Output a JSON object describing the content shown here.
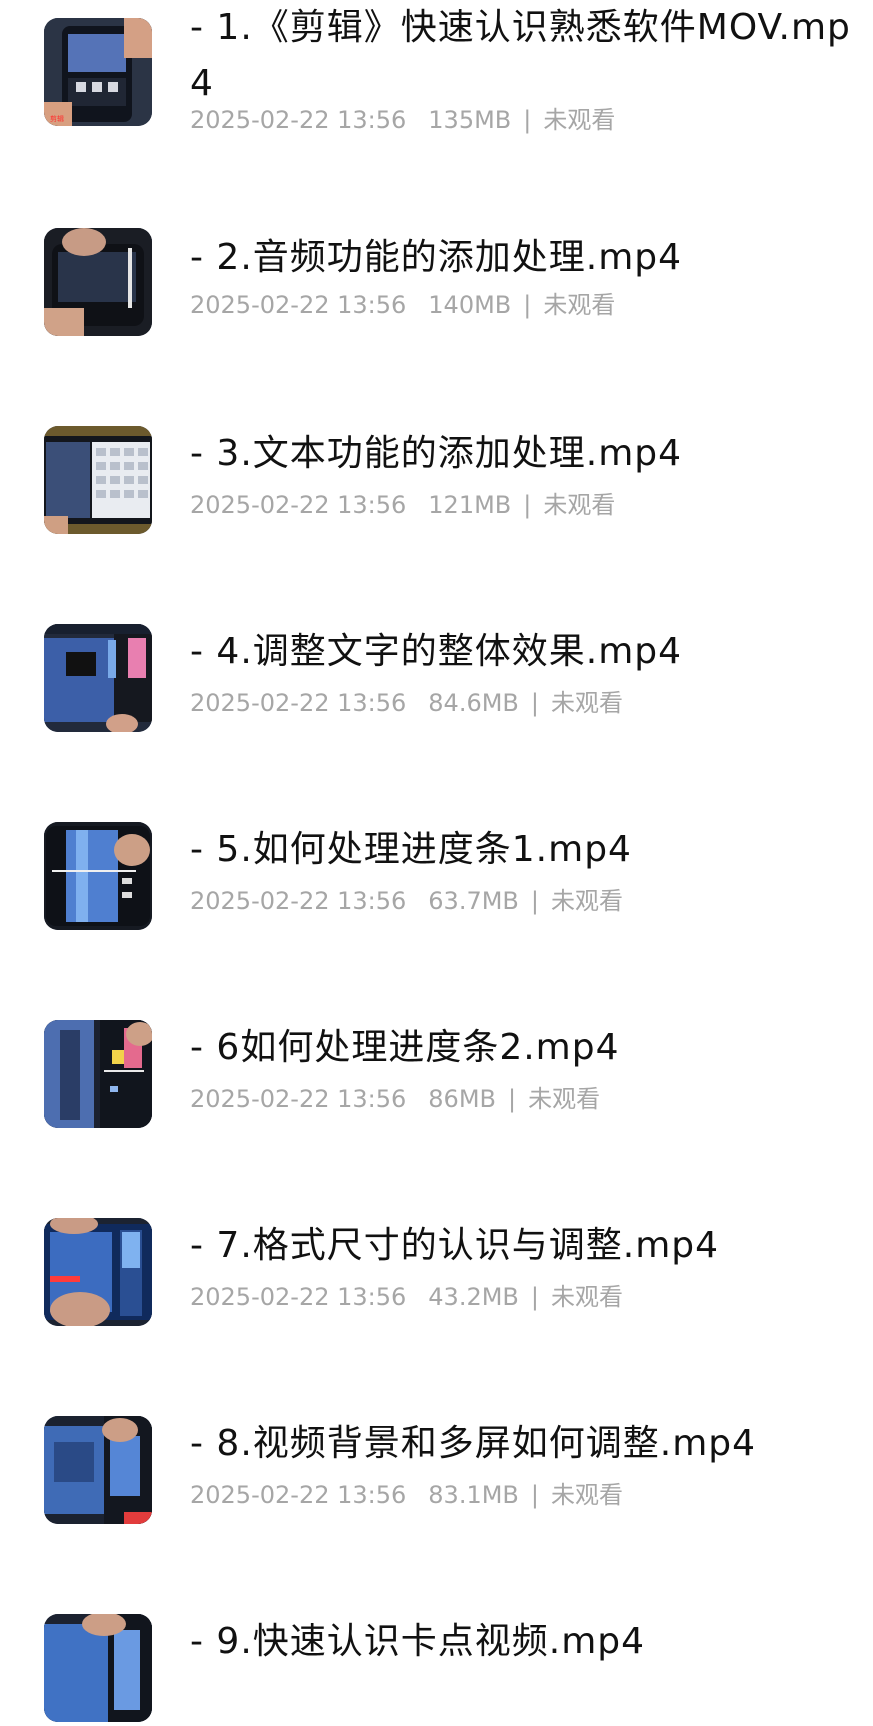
{
  "files": [
    {
      "title": "- 1.《剪辑》快速认识熟悉软件MOV.mp4",
      "date": "2025-02-22 13:56",
      "size": "135MB",
      "status": "未观看",
      "thumb": "phone-dark"
    },
    {
      "title": "- 2.音频功能的添加处理.mp4",
      "date": "2025-02-22 13:56",
      "size": "140MB",
      "status": "未观看",
      "thumb": "phone-hand"
    },
    {
      "title": "- 3.文本功能的添加处理.mp4",
      "date": "2025-02-22 13:56",
      "size": "121MB",
      "status": "未观看",
      "thumb": "keyboard"
    },
    {
      "title": "- 4.调整文字的整体效果.mp4",
      "date": "2025-02-22 13:56",
      "size": "84.6MB",
      "status": "未观看",
      "thumb": "phone-pink"
    },
    {
      "title": "- 5.如何处理进度条1.mp4",
      "date": "2025-02-22 13:56",
      "size": "63.7MB",
      "status": "未观看",
      "thumb": "phone-blue"
    },
    {
      "title": "- 6如何处理进度条2.mp4",
      "date": "2025-02-22 13:56",
      "size": "86MB",
      "status": "未观看",
      "thumb": "phone-pink"
    },
    {
      "title": "- 7.格式尺寸的认识与调整.mp4",
      "date": "2025-02-22 13:56",
      "size": "43.2MB",
      "status": "未观看",
      "thumb": "phone-blue"
    },
    {
      "title": "- 8.视频背景和多屏如何调整.mp4",
      "date": "2025-02-22 13:56",
      "size": "83.1MB",
      "status": "未观看",
      "thumb": "phone-blue"
    },
    {
      "title": "- 9.快速认识卡点视频.mp4",
      "date": "",
      "size": "",
      "status": "",
      "thumb": "phone-blue"
    }
  ],
  "separator": "|"
}
